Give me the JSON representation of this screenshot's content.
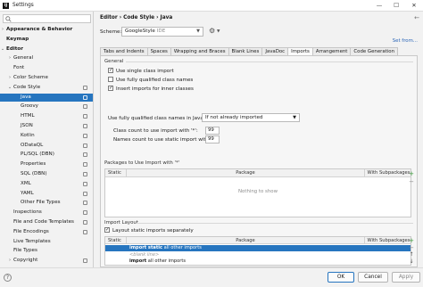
{
  "window": {
    "title": "Settings",
    "app_icon": "IJ"
  },
  "window_controls": {
    "minimize": "—",
    "maximize": "☐",
    "close": "✕"
  },
  "sidebar": {
    "search_placeholder": "",
    "items": [
      {
        "label": "Appearance & Behavior",
        "level": 0,
        "expand": "›",
        "bold": true
      },
      {
        "label": "Keymap",
        "level": 0,
        "bold": true
      },
      {
        "label": "Editor",
        "level": 0,
        "expand": "⌄",
        "bold": true
      },
      {
        "label": "General",
        "level": 1,
        "expand": "›"
      },
      {
        "label": "Font",
        "level": 1
      },
      {
        "label": "Color Scheme",
        "level": 1,
        "expand": "›"
      },
      {
        "label": "Code Style",
        "level": 1,
        "expand": "⌄",
        "project": true
      },
      {
        "label": "Java",
        "level": 2,
        "project": true,
        "selected": true
      },
      {
        "label": "Groovy",
        "level": 2,
        "project": true
      },
      {
        "label": "HTML",
        "level": 2,
        "project": true
      },
      {
        "label": "JSON",
        "level": 2,
        "project": true
      },
      {
        "label": "Kotlin",
        "level": 2,
        "project": true
      },
      {
        "label": "ODataQL",
        "level": 2,
        "project": true
      },
      {
        "label": "PL/SQL (DBN)",
        "level": 2,
        "project": true
      },
      {
        "label": "Properties",
        "level": 2,
        "project": true
      },
      {
        "label": "SQL (DBN)",
        "level": 2,
        "project": true
      },
      {
        "label": "XML",
        "level": 2,
        "project": true
      },
      {
        "label": "YAML",
        "level": 2,
        "project": true
      },
      {
        "label": "Other File Types",
        "level": 2,
        "project": true
      },
      {
        "label": "Inspections",
        "level": 1,
        "project": true
      },
      {
        "label": "File and Code Templates",
        "level": 1,
        "project": true
      },
      {
        "label": "File Encodings",
        "level": 1,
        "project": true
      },
      {
        "label": "Live Templates",
        "level": 1
      },
      {
        "label": "File Types",
        "level": 1
      },
      {
        "label": "Copyright",
        "level": 1,
        "expand": "›",
        "project": true
      }
    ]
  },
  "main": {
    "breadcrumb": "Editor  ›  Code Style  ›  Java",
    "reset_icon": "←",
    "scheme_label": "Scheme:",
    "scheme_value": "GoogleStyle",
    "scheme_suffix": "IDE",
    "gear_icon": "⚙",
    "set_from": "Set from...",
    "tabs": [
      {
        "label": "Tabs and Indents"
      },
      {
        "label": "Spaces"
      },
      {
        "label": "Wrapping and Braces"
      },
      {
        "label": "Blank Lines"
      },
      {
        "label": "JavaDoc"
      },
      {
        "label": "Imports",
        "active": true
      },
      {
        "label": "Arrangement"
      },
      {
        "label": "Code Generation"
      }
    ],
    "general": {
      "title": "General",
      "checkboxes": [
        {
          "label": "Use single class import",
          "checked": true
        },
        {
          "label": "Use fully qualified class names",
          "checked": false
        },
        {
          "label": "Insert imports for inner classes",
          "checked": true
        }
      ],
      "fq_javadoc_label": "Use fully qualified class names in JavaDoc:",
      "fq_javadoc_value": "If not already imported",
      "class_count_label": "Class count to use import with '*':",
      "class_count_value": "99",
      "names_count_label": "Names count to use static import with '*':",
      "names_count_value": "99"
    },
    "packages_table": {
      "title": "Packages to Use Import with '*'",
      "columns": [
        "Static",
        "Package",
        "With Subpackages"
      ],
      "empty_text": "Nothing to show",
      "tools": [
        "+",
        "−"
      ]
    },
    "import_layout": {
      "title": "Import Layout",
      "static_separately_label": "Layout static imports separately",
      "static_separately_checked": true,
      "columns": [
        "Static",
        "Package",
        "With Subpackages"
      ],
      "rows": [
        {
          "keyword": "import static",
          "rest": "all other imports",
          "selected": true
        },
        {
          "keyword": "",
          "rest": "<blank line>",
          "muted": true
        },
        {
          "keyword": "import",
          "rest": "all other imports"
        }
      ],
      "tools": [
        "+",
        "−",
        "↑",
        "↓"
      ]
    }
  },
  "footer": {
    "help_icon": "?",
    "ok": "OK",
    "cancel": "Cancel",
    "apply": "Apply"
  },
  "colors": {
    "accent": "#2675bf",
    "link": "#2b66b8"
  }
}
